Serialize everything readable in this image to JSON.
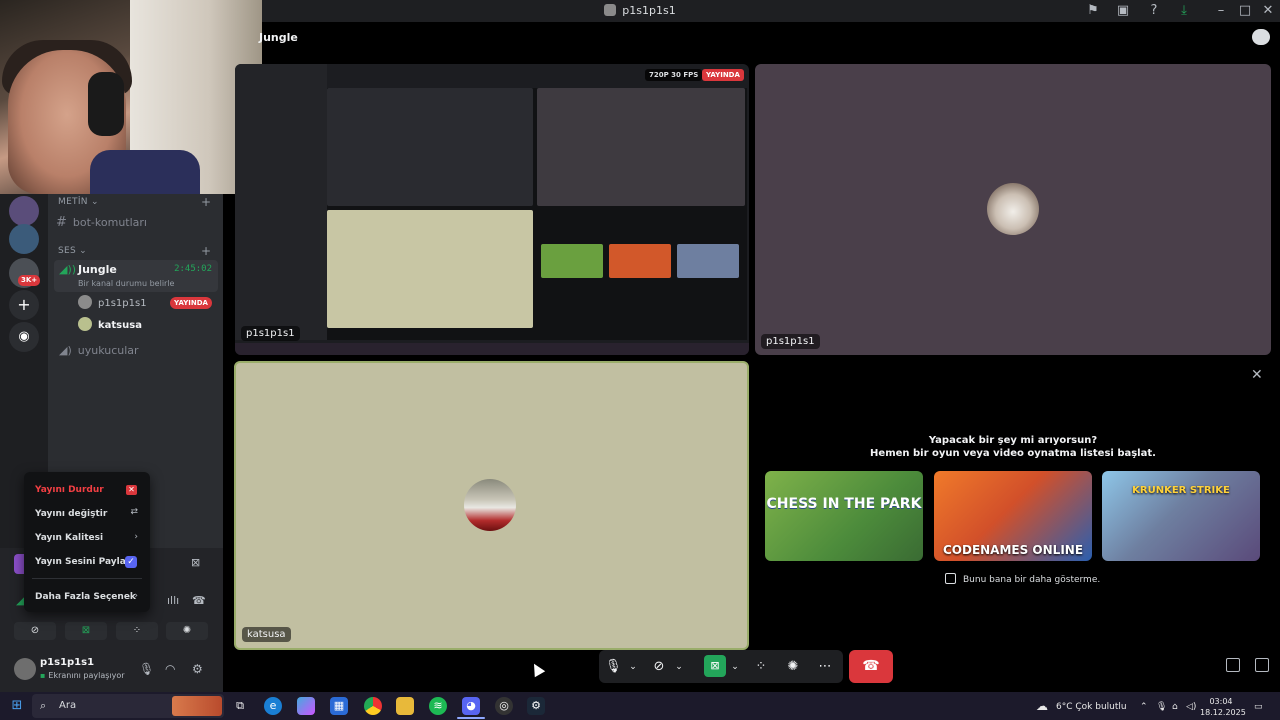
{
  "window": {
    "title": "p1s1p1s1"
  },
  "stage": {
    "channel_title": "Jungle"
  },
  "sidebar": {
    "category_text": "METİN",
    "text_channel": "bot-komutları",
    "category_voice": "SES",
    "voice_channel": {
      "name": "Jungle",
      "timer": "2:45:02",
      "status": "Bir kanal durumu belirle"
    },
    "members": [
      {
        "name": "p1s1p1s1",
        "badge": "YAYINDA"
      },
      {
        "name": "katsusa"
      }
    ],
    "other_voice_channel": "uyukucular",
    "server_badge": "3K+"
  },
  "tiles": {
    "screen_share_label": "p1s1p1s1",
    "quality": "720P 30 FPS",
    "live": "YAYINDA",
    "camera_label": "p1s1p1s1",
    "katsusa_label": "katsusa"
  },
  "activities": {
    "title_line1": "Yapacak bir şey mi arıyorsun?",
    "title_line2": "Hemen bir oyun veya video oynatma listesi başlat.",
    "games": [
      {
        "name": "CHESS IN THE PARK"
      },
      {
        "name": "CODENAMES ONLINE"
      },
      {
        "name": "KRUNKER STRIKE"
      }
    ],
    "dont_show": "Bunu bana bir daha gösterme."
  },
  "menu": {
    "items": [
      {
        "label": "Yayını Durdur"
      },
      {
        "label": "Yayını değiştir"
      },
      {
        "label": "Yayın Kalitesi"
      },
      {
        "label": "Yayın Sesini Paylaş"
      },
      {
        "label": "Daha Fazla Seçenek"
      }
    ]
  },
  "user": {
    "name": "p1s1p1s1",
    "status": "Ekranını paylaşıyor"
  },
  "taskbar": {
    "search_label": "Ara",
    "weather": "6°C  Çok bulutlu",
    "time": "03:04",
    "date": "18.12.2025"
  },
  "colors": {
    "accent": "#5865f2",
    "danger": "#da373c",
    "online": "#23a55a"
  }
}
